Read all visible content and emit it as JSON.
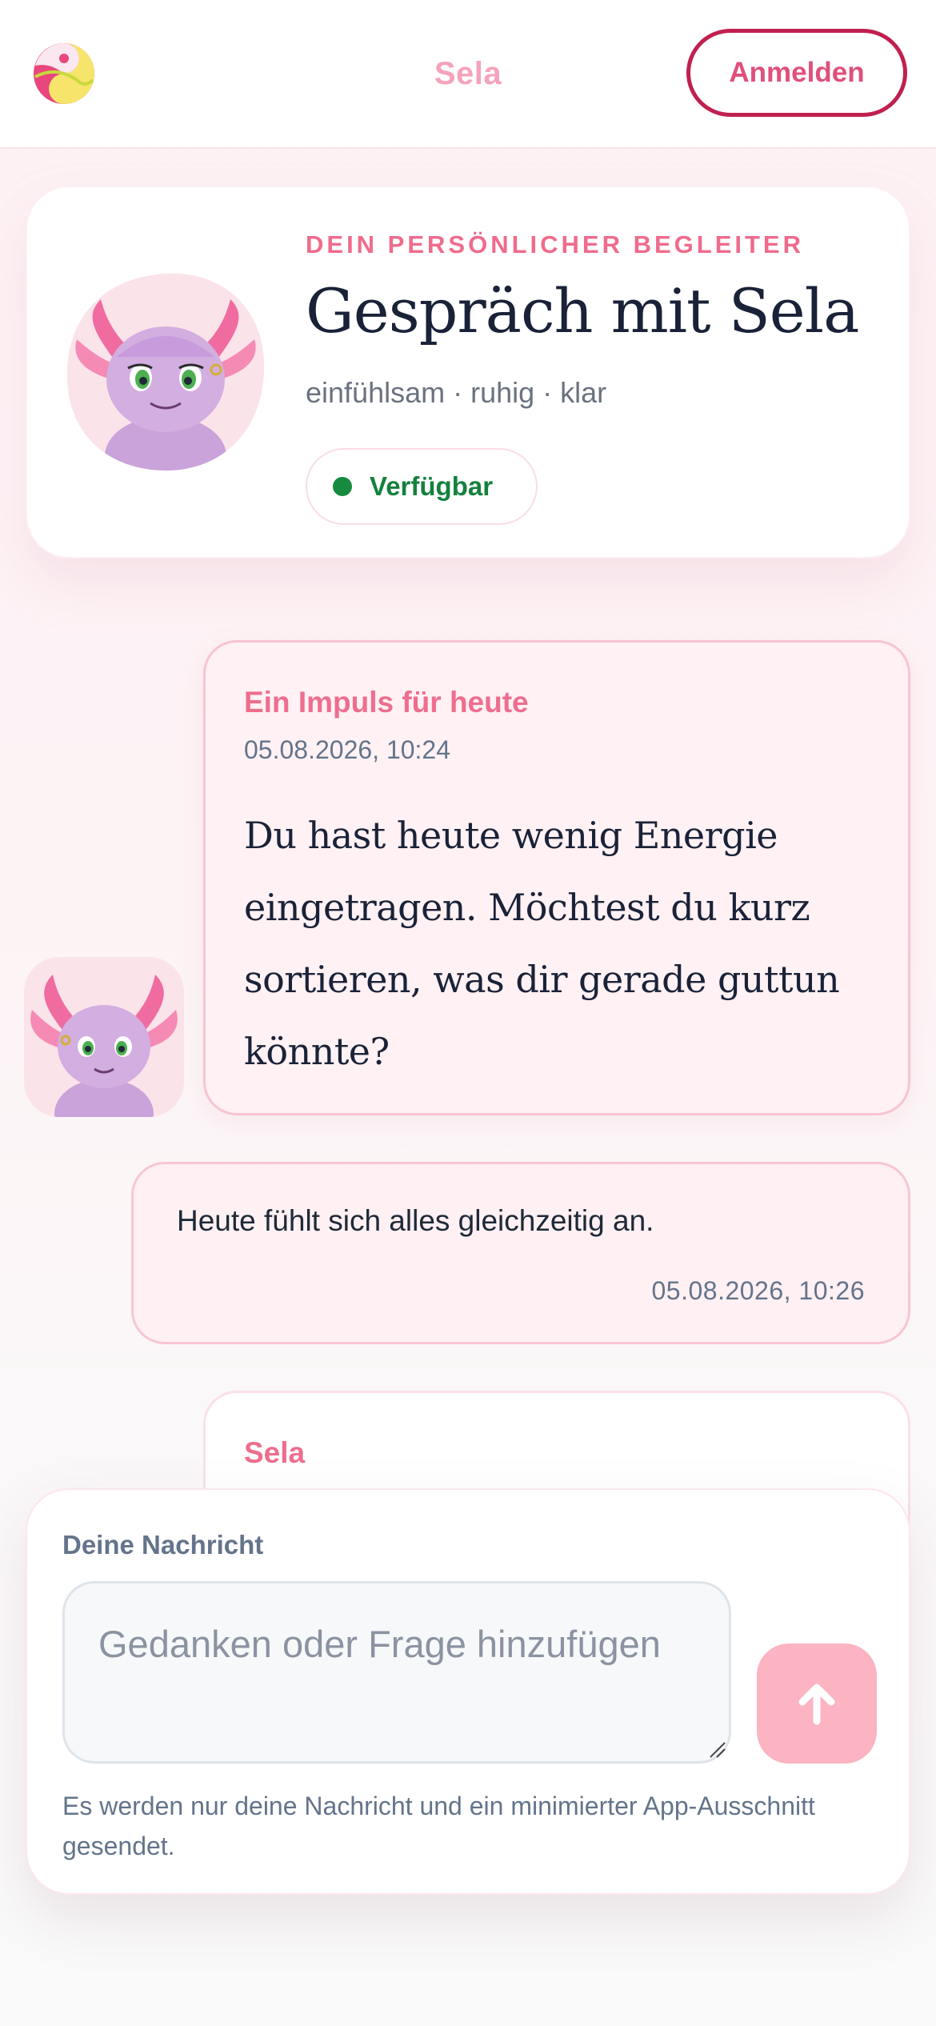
{
  "header": {
    "app_title": "Sela",
    "login_label": "Anmelden",
    "logo_icon": "yin-yang-logo-icon"
  },
  "profile": {
    "eyebrow": "DEIN PERSÖNLICHER BEGLEITER",
    "title": "Gespräch mit Sela",
    "subtitle": "einfühlsam · ruhig · klar",
    "status": "Verfügbar",
    "status_color": "#168a3f",
    "avatar_icon": "axolotl-avatar-icon"
  },
  "messages": [
    {
      "sender": "assistant",
      "title": "Ein Impuls für heute",
      "time": "05.08.2026, 10:24",
      "text": "Du hast heute wenig Energie eingetragen. Möchtest du kurz sortieren, was dir gerade guttun könnte?"
    },
    {
      "sender": "user",
      "text": "Heute fühlt sich alles gleichzeitig an.",
      "time": "05.08.2026, 10:26"
    },
    {
      "sender": "assistant",
      "name": "Sela"
    }
  ],
  "composer": {
    "label": "Deine Nachricht",
    "placeholder": "Gedanken oder Frage hinzufügen",
    "value": "",
    "send_icon": "arrow-up-icon",
    "note": "Es werden nur deine Nachricht und ein minimierter App-Ausschnitt gesendet."
  },
  "colors": {
    "accent": "#ee6e8d",
    "login_border": "#c0204f",
    "send_bg": "#fcb3c2",
    "bubble_bg": "#fff1f4"
  }
}
